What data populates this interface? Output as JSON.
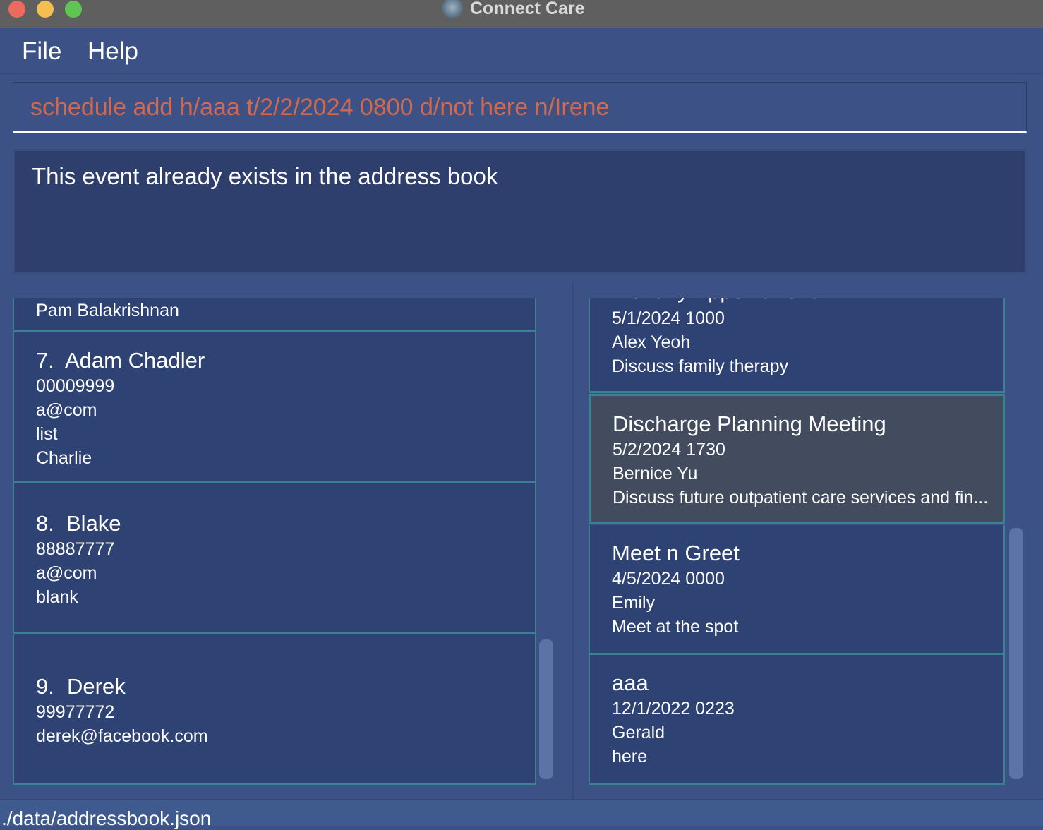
{
  "window": {
    "title": "Connect Care"
  },
  "menu": {
    "file": "File",
    "help": "Help"
  },
  "command": {
    "value": "schedule add h/aaa t/2/2/2024 0800 d/not here n/Irene"
  },
  "result": {
    "message": "This event already exists in the address book"
  },
  "persons": [
    {
      "partial_name": "Pam Balakrishnan"
    },
    {
      "index": "7.",
      "name": "Adam Chadler",
      "phone": "00009999",
      "email": "a@com",
      "line3": "list",
      "line4": "Charlie"
    },
    {
      "index": "8.",
      "name": "Blake",
      "phone": "88887777",
      "email": "a@com",
      "line3": "blank"
    },
    {
      "index": "9.",
      "name": "Derek",
      "phone": "99977772",
      "email": "derek@facebook.com"
    }
  ],
  "events": [
    {
      "partial_title": "Monthly Appointment",
      "time": "5/1/2024 1000",
      "person": "Alex Yeoh",
      "desc": "Discuss family therapy"
    },
    {
      "title": "Discharge Planning Meeting",
      "time": "5/2/2024 1730",
      "person": "Bernice Yu",
      "desc": "Discuss future outpatient care services and fin..."
    },
    {
      "title": "Meet n Greet",
      "time": "4/5/2024 0000",
      "person": "Emily",
      "desc": "Meet at the spot"
    },
    {
      "title": "aaa",
      "time": "12/1/2022 0223",
      "person": "Gerald",
      "desc": "here"
    }
  ],
  "status": {
    "path": "./data/addressbook.json"
  },
  "colors": {
    "background": "#3c5287",
    "card": "#2e4273",
    "card_selected": "#424c5e",
    "card_border": "#3a8191",
    "command_error": "#d2694e"
  }
}
